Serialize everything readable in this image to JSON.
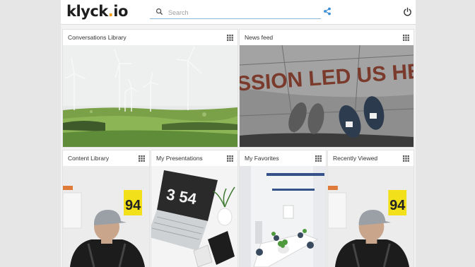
{
  "app": {
    "logo_text": "klyck",
    "logo_dot": ".",
    "logo_suffix": "io",
    "brand_color": "#f2a019"
  },
  "search": {
    "placeholder": "Search",
    "value": "",
    "icon": "search-icon"
  },
  "header_icons": {
    "share": "share-icon",
    "power": "power-icon"
  },
  "tiles": [
    {
      "title": "Conversations Library",
      "icon": "grid-icon",
      "image": "wind-turbines-photo"
    },
    {
      "title": "News feed",
      "icon": "grid-icon",
      "image": "sneakers-on-pavement-photo",
      "image_text": "SSION LED US HE"
    },
    {
      "title": "Content Library",
      "icon": "grid-icon",
      "image": "person-with-cap-photo",
      "image_text": "94"
    },
    {
      "title": "My Presentations",
      "icon": "grid-icon",
      "image": "laptop-clock-desk-photo",
      "image_text": "3 54"
    },
    {
      "title": "My Favorites",
      "icon": "grid-icon",
      "image": "meeting-room-photo"
    },
    {
      "title": "Recently Viewed",
      "icon": "grid-icon",
      "image": "person-with-cap-photo",
      "image_text": "94"
    }
  ]
}
